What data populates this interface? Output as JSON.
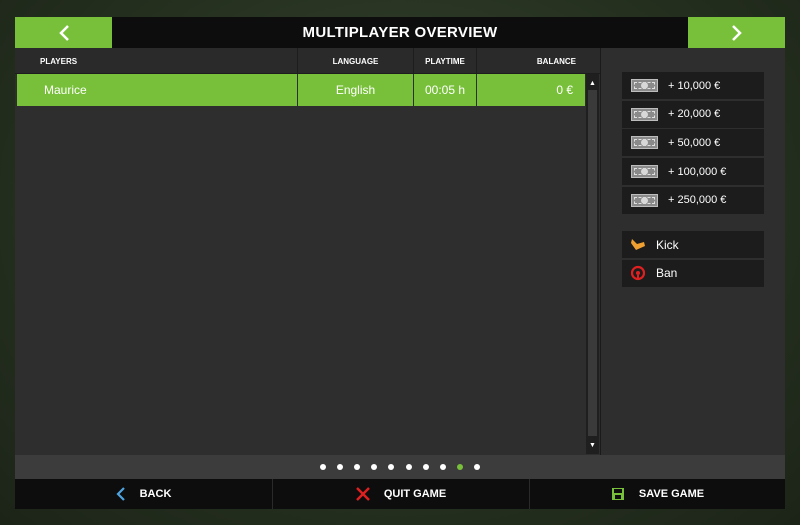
{
  "header": {
    "title": "MULTIPLAYER OVERVIEW",
    "prev_icon": "chevron-left-icon",
    "next_icon": "chevron-right-icon"
  },
  "table": {
    "columns": [
      "PLAYERS",
      "LANGUAGE",
      "PLAYTIME",
      "BALANCE"
    ],
    "rows": [
      {
        "player": "Maurice",
        "language": "English",
        "playtime": "00:05 h",
        "balance": "0 €"
      }
    ]
  },
  "money_buttons": [
    "+ 10,000 €",
    "+ 20,000 €",
    "+ 50,000 €",
    "+ 100,000 €",
    "+ 250,000 €"
  ],
  "actions": {
    "kick": "Kick",
    "ban": "Ban"
  },
  "pager": {
    "page_count": 10,
    "active_page": 9
  },
  "footer": {
    "back": "BACK",
    "quit": "QUIT GAME",
    "save": "SAVE GAME"
  },
  "colors": {
    "accent": "#78c03a",
    "panel": "#2e2e2e",
    "bar": "#0d0d0d",
    "kick": "#f0a030",
    "ban": "#e02020",
    "quit": "#e02020",
    "back": "#4fa3e0"
  }
}
